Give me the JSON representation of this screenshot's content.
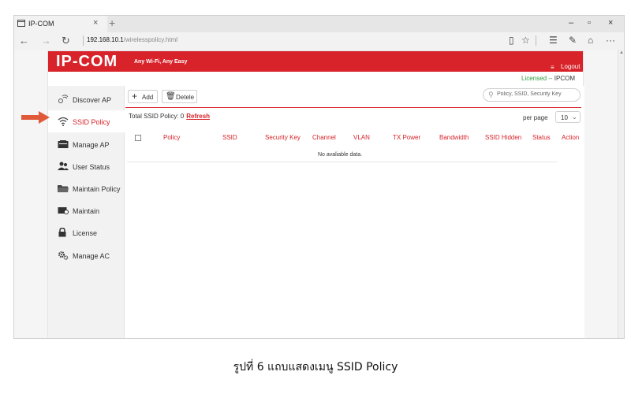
{
  "browser": {
    "tab_title": "IP-COM",
    "tab_close": "×",
    "new_tab": "+",
    "window_controls": [
      "–",
      "▫",
      "×"
    ],
    "nav": {
      "back": "←",
      "forward": "→",
      "refresh": "↻"
    },
    "address_host": "192.168.10.1",
    "address_path": "/wirelesspolicy.html",
    "toolbar_icons": [
      "reading-view-icon",
      "favorite-star-icon",
      "hub-icon",
      "note-icon",
      "share-icon",
      "more-icon"
    ],
    "toolbar_glyphs": [
      "▯",
      "☆",
      "☰",
      "✎",
      "⌂",
      "···"
    ]
  },
  "app": {
    "logo": "IP-COM",
    "tagline": "Any Wi-Fi, Any Easy",
    "logout": "Logout",
    "licensed_label": "Licensed -- ",
    "licensed_name": "IPCOM",
    "brand_color": "#d8232a",
    "sidebar": {
      "items": [
        {
          "label": "Discover AP",
          "icon": "discover-ap-icon"
        },
        {
          "label": "SSID Policy",
          "icon": "wifi-icon"
        },
        {
          "label": "Manage AP",
          "icon": "access-point-icon"
        },
        {
          "label": "User Status",
          "icon": "users-icon"
        },
        {
          "label": "Maintain Policy",
          "icon": "folder-icon"
        },
        {
          "label": "Maintain",
          "icon": "maintain-icon"
        },
        {
          "label": "License",
          "icon": "lock-icon"
        },
        {
          "label": "Manage AC",
          "icon": "gears-icon"
        }
      ],
      "active_index": 1
    },
    "toolbar": {
      "add_label": "Add",
      "delete_label": "Detele",
      "search_placeholder": "Policy, SSID, Security Key"
    },
    "total_label": "Total SSID Policy: 0",
    "refresh_label": "Refresh",
    "per_page_label": "per page",
    "per_page_value": "10",
    "table": {
      "columns": [
        "Policy",
        "SSID",
        "Security Key",
        "Channel",
        "VLAN",
        "TX Power",
        "Bandwidth",
        "SSID Hidden",
        "Status",
        "Action"
      ],
      "empty_text": "No avaliable data."
    }
  },
  "caption": "รูปที่ 6 แถบแสดงเมนู SSID Policy"
}
